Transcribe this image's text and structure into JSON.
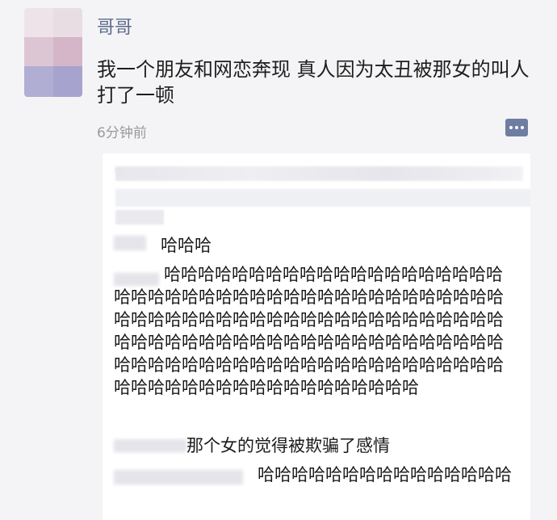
{
  "post": {
    "username": "哥哥",
    "text": "我一个朋友和网恋奔现 真人因为太丑被那女的叫人打了一顿",
    "time": "6分钟前"
  },
  "colors": {
    "username": "#5e6b8f",
    "comment_button": "#6f7da3",
    "background": "#f4f4f6",
    "card": "#ffffff"
  },
  "icons": {
    "comment": "comment-dots-icon",
    "like": "heart-icon"
  },
  "comments": [
    {
      "text": "哈哈哈"
    },
    {
      "text": "哈哈哈哈哈哈哈哈哈哈哈哈哈哈哈哈哈哈哈哈哈哈哈哈哈哈哈哈哈哈哈哈哈哈哈哈哈哈哈哈哈哈哈哈哈哈哈哈哈哈哈哈哈哈哈哈哈哈哈哈哈哈哈哈哈哈哈哈哈哈哈哈哈哈哈哈哈哈哈哈哈哈哈哈哈哈哈哈哈哈哈哈哈哈哈哈哈哈哈哈哈哈哈哈哈哈哈哈哈哈哈哈哈哈哈哈哈哈哈哈哈哈哈哈哈哈哈哈哈哈"
    },
    {
      "text": "那个女的觉得被欺骗了感情"
    },
    {
      "text": "哈哈哈哈哈哈哈哈哈哈哈哈哈哈哈"
    }
  ]
}
